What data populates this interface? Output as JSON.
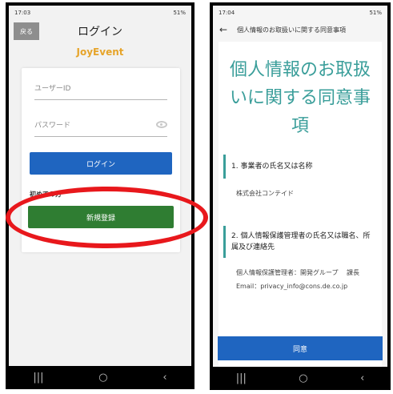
{
  "left": {
    "status": {
      "time": "17:03",
      "battery": "51%"
    },
    "header": {
      "back_label": "戻る",
      "title": "ログイン"
    },
    "brand": "JoyEvent",
    "form": {
      "userid_placeholder": "ユーザーID",
      "password_placeholder": "パスワード",
      "login_label": "ログイン",
      "first_time_label": "初めての方",
      "register_label": "新規登録"
    }
  },
  "right": {
    "status": {
      "time": "17:04",
      "battery": "51%"
    },
    "header": {
      "title": "個人情報のお取扱いに関する同意事項"
    },
    "title": "個人情報のお取扱いに関する同意事項",
    "sections": [
      {
        "heading": "1. 事業者の氏名又は名称",
        "body": "株式会社コンテイド"
      },
      {
        "heading": "2. 個人情報保護管理者の氏名又は職名、所属及び連絡先",
        "body_lines": [
          "個人情報保護管理者：開発グループ 　課長",
          "Email：privacy_info@cons.de.co.jp"
        ]
      }
    ],
    "agree_label": "同意"
  },
  "colors": {
    "teal": "#3a9e9a",
    "blue": "#1f65c0",
    "green": "#2f7d32",
    "highlight": "#e8181c",
    "brand": "#e6a42a"
  }
}
